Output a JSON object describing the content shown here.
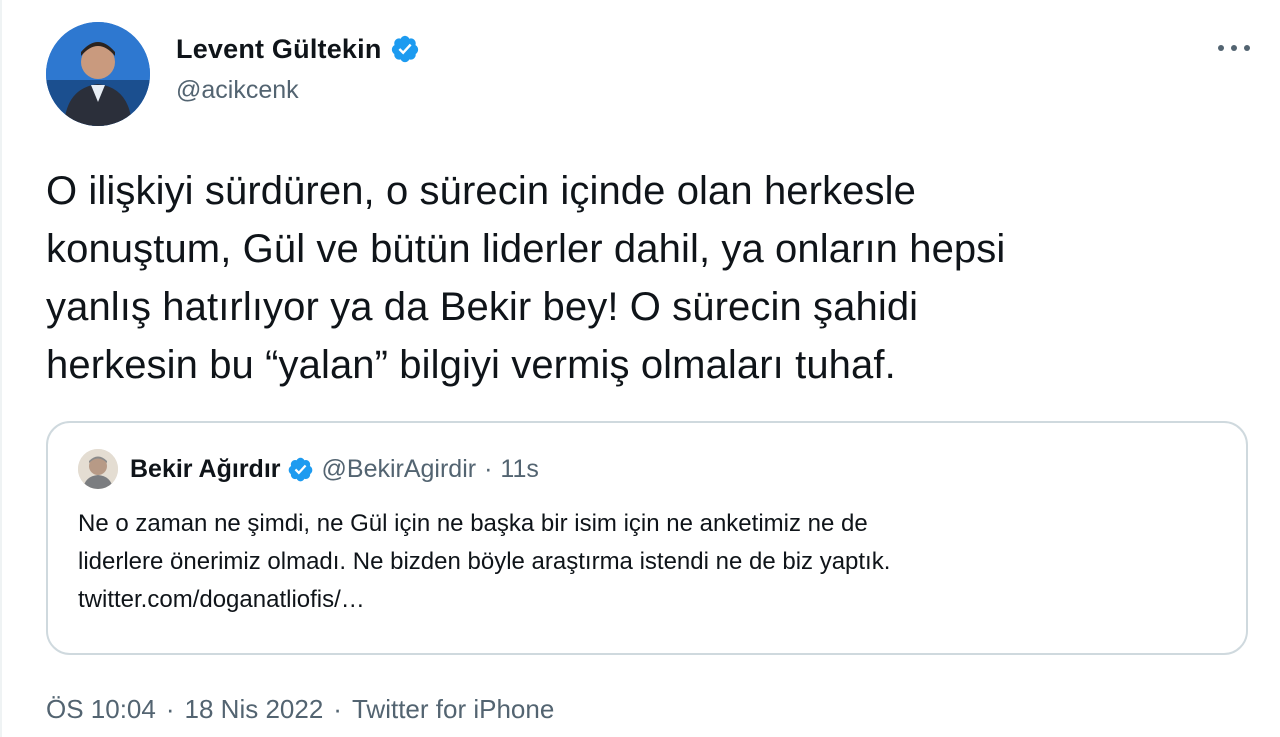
{
  "author": {
    "display_name": "Levent Gültekin",
    "handle": "@acikcenk",
    "avatar_icon": "user-photo-icon",
    "verified_icon": "verified-badge-icon"
  },
  "more_icon": "more-dots-icon",
  "tweet_lines": [
    "O ilişkiyi sürdüren, o sürecin içinde olan herkesle",
    "konuştum, Gül ve bütün liderler dahil, ya onların hepsi",
    "yanlış hatırlıyor ya da Bekir bey! O sürecin şahidi",
    "herkesin bu “yalan” bilgiyi vermiş olmaları tuhaf."
  ],
  "quoted": {
    "display_name": "Bekir Ağırdır",
    "handle": "@BekirAgirdir",
    "separator": "·",
    "time": "11s",
    "lines": [
      "Ne o zaman ne şimdi, ne Gül için ne başka bir isim için ne anketimiz ne de",
      "liderlere önerimiz olmadı. Ne bizden böyle araştırma istendi ne de biz yaptık.",
      "twitter.com/doganatliofis/…"
    ]
  },
  "meta": {
    "time": "ÖS 10:04",
    "sep1": "·",
    "date": "18 Nis 2022",
    "sep2": "·",
    "source": "Twitter for iPhone"
  },
  "colors": {
    "verified": "#1d9bf0",
    "text": "#0f1419",
    "secondary": "#536471",
    "border": "#cfd9de"
  }
}
